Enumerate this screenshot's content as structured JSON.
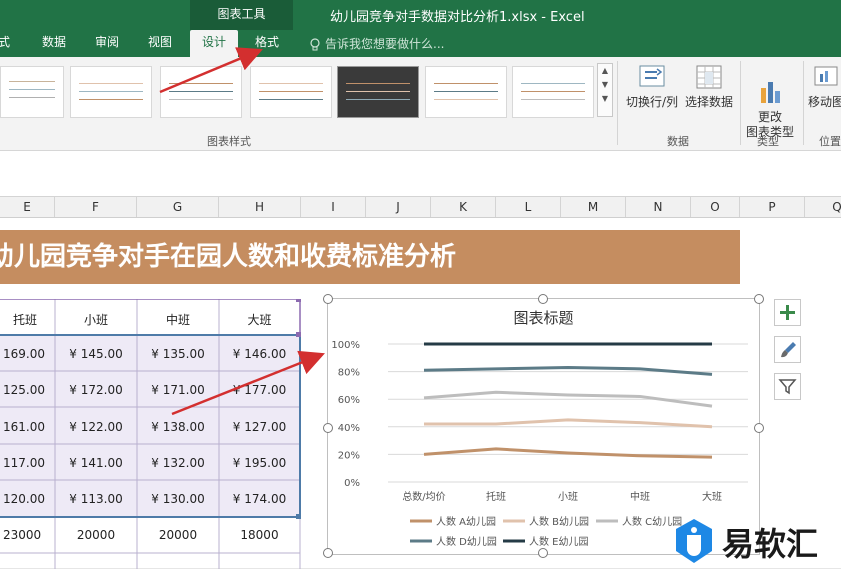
{
  "window": {
    "chart_tools_label": "图表工具",
    "doc_title": "幼儿园竞争对手数据对比分析1.xlsx - Excel"
  },
  "tabs": [
    {
      "label": "式",
      "active": false
    },
    {
      "label": "数据",
      "active": false
    },
    {
      "label": "审阅",
      "active": false
    },
    {
      "label": "视图",
      "active": false
    },
    {
      "label": "设计",
      "active": true
    },
    {
      "label": "格式",
      "active": false
    }
  ],
  "tell_me": "告诉我您想要做什么...",
  "ribbon": {
    "switch_row_col": "切换行/列",
    "select_data": "选择数据",
    "change_chart_type": "更改\n图表类型",
    "move_chart": "移动图",
    "group_chart_styles": "图表样式",
    "group_data": "数据",
    "group_type": "类型",
    "group_location": "位置"
  },
  "columns": [
    "E",
    "F",
    "G",
    "H",
    "I",
    "J",
    "K",
    "L",
    "M",
    "N",
    "O",
    "P",
    "Q"
  ],
  "banner": "幼儿园竞争对手在园人数和收费标准分析",
  "table": {
    "headers": [
      "托班",
      "小班",
      "中班",
      "大班"
    ],
    "rows": [
      [
        "169.00",
        "¥ 145.00",
        "¥ 135.00",
        "¥ 146.00"
      ],
      [
        "125.00",
        "¥ 172.00",
        "¥ 171.00",
        "¥ 177.00"
      ],
      [
        "161.00",
        "¥ 122.00",
        "¥ 138.00",
        "¥ 127.00"
      ],
      [
        "117.00",
        "¥ 141.00",
        "¥ 132.00",
        "¥ 195.00"
      ],
      [
        "120.00",
        "¥ 113.00",
        "¥ 130.00",
        "¥ 174.00"
      ],
      [
        "23000",
        "20000",
        "20000",
        "18000"
      ]
    ]
  },
  "chart_data": {
    "type": "line",
    "title": "图表标题",
    "categories": [
      "总数/均价",
      "托班",
      "小班",
      "中班",
      "大班"
    ],
    "ylim": [
      0,
      1
    ],
    "yticks": [
      "0%",
      "20%",
      "40%",
      "60%",
      "80%",
      "100%"
    ],
    "grid": true,
    "legend_position": "bottom",
    "series": [
      {
        "name": "人数 A幼儿园",
        "color": "#c0916a",
        "values": [
          0.2,
          0.24,
          0.21,
          0.19,
          0.18
        ]
      },
      {
        "name": "人数 B幼儿园",
        "color": "#e0c2ac",
        "values": [
          0.42,
          0.42,
          0.45,
          0.43,
          0.4
        ]
      },
      {
        "name": "人数 C幼儿园",
        "color": "#bdbdbd",
        "values": [
          0.61,
          0.65,
          0.63,
          0.62,
          0.55
        ]
      },
      {
        "name": "人数 D幼儿园",
        "color": "#5c7b87",
        "values": [
          0.81,
          0.82,
          0.83,
          0.82,
          0.78
        ]
      },
      {
        "name": "人数 E幼儿园",
        "color": "#253b46",
        "values": [
          1.0,
          1.0,
          1.0,
          1.0,
          1.0
        ]
      }
    ]
  },
  "watermark": "易软汇",
  "colors": {
    "excel_green": "#217346",
    "banner": "#c58d60",
    "arrow": "#d32f2f"
  }
}
